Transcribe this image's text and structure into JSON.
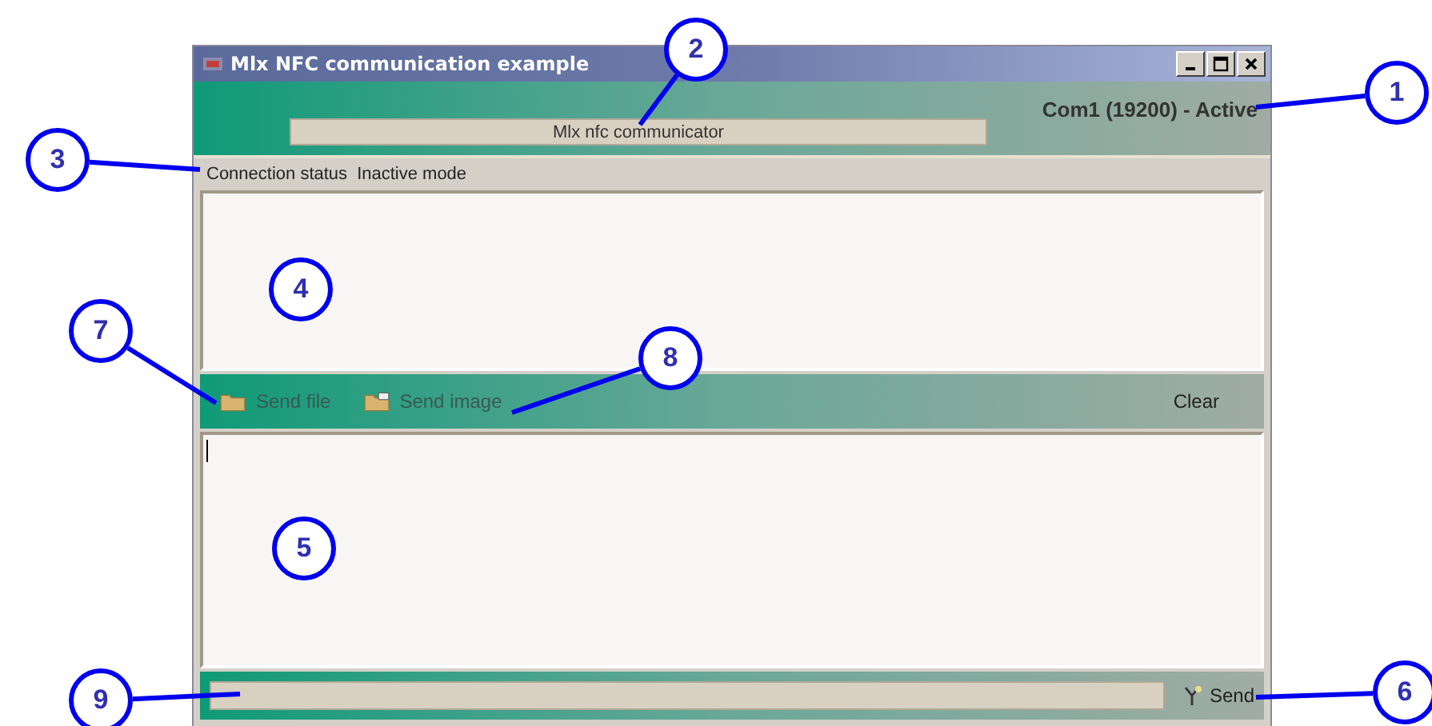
{
  "window": {
    "title": "Mlx NFC communication example"
  },
  "header": {
    "port_status": "Com1 (19200) - Active",
    "title_field": "Mlx nfc communicator"
  },
  "connection": {
    "label": "Connection status",
    "value": "Inactive mode"
  },
  "toolbar": [
    {
      "label": "Send file",
      "kind": "file",
      "disabled": true
    },
    {
      "label": "Send image",
      "kind": "image",
      "disabled": true
    },
    {
      "label": "Clear",
      "kind": "plain",
      "disabled": false
    }
  ],
  "send_button": {
    "label": "Send"
  },
  "callouts": [
    "1",
    "2",
    "3",
    "4",
    "5",
    "6",
    "7",
    "8",
    "9"
  ]
}
